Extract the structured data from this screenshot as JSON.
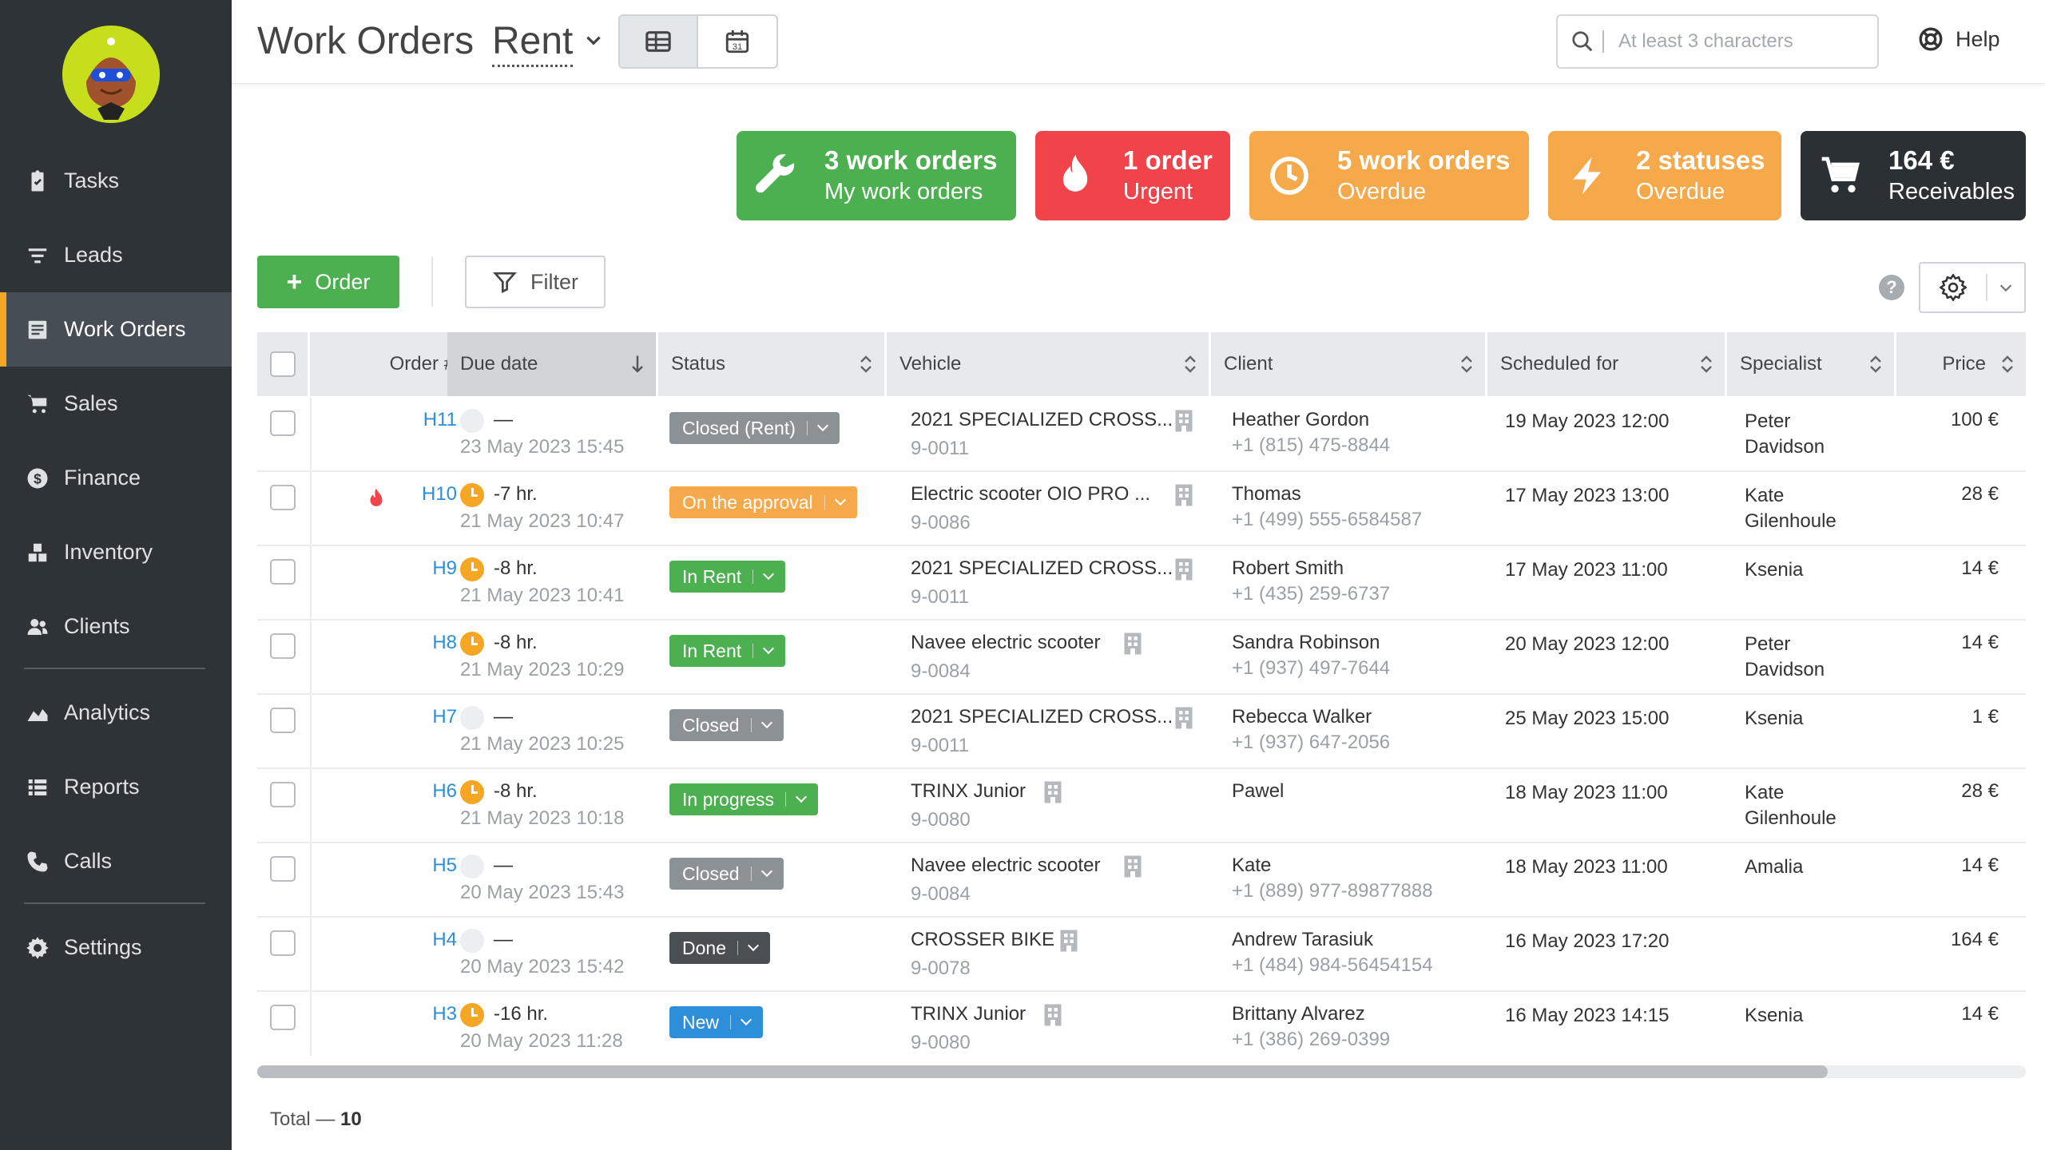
{
  "nav": {
    "tasks": "Tasks",
    "leads": "Leads",
    "work_orders": "Work Orders",
    "sales": "Sales",
    "finance": "Finance",
    "inventory": "Inventory",
    "clients": "Clients",
    "analytics": "Analytics",
    "reports": "Reports",
    "calls": "Calls",
    "settings": "Settings"
  },
  "header": {
    "title": "Work Orders",
    "subtitle": "Rent",
    "search_placeholder": "At least 3 characters",
    "help": "Help"
  },
  "cards": [
    {
      "line1": "3 work orders",
      "line2": "My work orders",
      "color": "#4caf50",
      "icon": "wrench-icon"
    },
    {
      "line1": "1 order",
      "line2": "Urgent",
      "color": "#f0434a",
      "icon": "flame-icon"
    },
    {
      "line1": "5 work orders",
      "line2": "Overdue",
      "color": "#f5a94a",
      "icon": "clock-icon"
    },
    {
      "line1": "2 statuses",
      "line2": "Overdue",
      "color": "#f5a94a",
      "icon": "lightning-icon"
    },
    {
      "line1": "164 €",
      "line2": "Receivables",
      "color": "#2b3035",
      "icon": "cart-icon"
    }
  ],
  "actions": {
    "order": "Order",
    "filter": "Filter",
    "help_mark": "?"
  },
  "columns": {
    "order": "Order #",
    "due": "Due date",
    "status": "Status",
    "vehicle": "Vehicle",
    "client": "Client",
    "scheduled": "Scheduled for",
    "specialist": "Specialist",
    "price": "Price"
  },
  "rows": [
    {
      "order": "H11",
      "urgent": false,
      "due_icon": "gray",
      "due_top": "—",
      "due_bottom": "23 May 2023 15:45",
      "status": "Closed (Rent)",
      "status_color": "#8c9196",
      "vehicle": "2021 SPECIALIZED CROSS...",
      "vehicle_id": "9-0011",
      "client": "Heather Gordon",
      "phone": "+1 (815) 475-8844",
      "scheduled": "19 May 2023 12:00",
      "specialist_1": "Peter",
      "specialist_2": "Davidson",
      "price": "100 €"
    },
    {
      "order": "H10",
      "urgent": true,
      "due_icon": "orange",
      "due_top": "-7 hr.",
      "due_bottom": "21 May 2023 10:47",
      "status": "On the approval",
      "status_color": "#f5a94a",
      "vehicle": "Electric scooter OIO PRO ...",
      "vehicle_id": "9-0086",
      "client": "Thomas",
      "phone": "+1 (499) 555-6584587",
      "scheduled": "17 May 2023 13:00",
      "specialist_1": "Kate",
      "specialist_2": "Gilenhoule",
      "price": "28 €"
    },
    {
      "order": "H9",
      "urgent": false,
      "due_icon": "orange",
      "due_top": "-8 hr.",
      "due_bottom": "21 May 2023 10:41",
      "status": "In Rent",
      "status_color": "#4caf50",
      "vehicle": "2021 SPECIALIZED CROSS...",
      "vehicle_id": "9-0011",
      "client": "Robert Smith",
      "phone": "+1 (435) 259-6737",
      "scheduled": "17 May 2023 11:00",
      "specialist_1": "Ksenia",
      "specialist_2": "",
      "price": "14 €"
    },
    {
      "order": "H8",
      "urgent": false,
      "due_icon": "orange",
      "due_top": "-8 hr.",
      "due_bottom": "21 May 2023 10:29",
      "status": "In Rent",
      "status_color": "#4caf50",
      "vehicle": "Navee electric scooter",
      "vehicle_id": "9-0084",
      "client": "Sandra Robinson",
      "phone": "+1 (937) 497-7644",
      "scheduled": "20 May 2023 12:00",
      "specialist_1": "Peter",
      "specialist_2": "Davidson",
      "price": "14 €"
    },
    {
      "order": "H7",
      "urgent": false,
      "due_icon": "gray",
      "due_top": "—",
      "due_bottom": "21 May 2023 10:25",
      "status": "Closed",
      "status_color": "#8c9196",
      "vehicle": "2021 SPECIALIZED CROSS...",
      "vehicle_id": "9-0011",
      "client": "Rebecca Walker",
      "phone": "+1 (937) 647-2056",
      "scheduled": "25 May 2023 15:00",
      "specialist_1": "Ksenia",
      "specialist_2": "",
      "price": "1 €"
    },
    {
      "order": "H6",
      "urgent": false,
      "due_icon": "orange",
      "due_top": "-8 hr.",
      "due_bottom": "21 May 2023 10:18",
      "status": "In progress",
      "status_color": "#4caf50",
      "vehicle": "TRINX Junior",
      "vehicle_id": "9-0080",
      "client": "Pawel",
      "phone": "",
      "scheduled": "18 May 2023 11:00",
      "specialist_1": "Kate",
      "specialist_2": "Gilenhoule",
      "price": "28 €"
    },
    {
      "order": "H5",
      "urgent": false,
      "due_icon": "gray",
      "due_top": "—",
      "due_bottom": "20 May 2023 15:43",
      "status": "Closed",
      "status_color": "#8c9196",
      "vehicle": "Navee electric scooter",
      "vehicle_id": "9-0084",
      "client": "Kate",
      "phone": "+1 (889) 977-89877888",
      "scheduled": "18 May 2023 11:00",
      "specialist_1": "Amalia",
      "specialist_2": "",
      "price": "14 €"
    },
    {
      "order": "H4",
      "urgent": false,
      "due_icon": "gray",
      "due_top": "—",
      "due_bottom": "20 May 2023 15:42",
      "status": "Done",
      "status_color": "#4a4f54",
      "vehicle": "CROSSER BIKE",
      "vehicle_id": "9-0078",
      "client": "Andrew Tarasiuk",
      "phone": "+1 (484) 984-56454154",
      "scheduled": "16 May 2023 17:20",
      "specialist_1": "",
      "specialist_2": "",
      "price": "164 €"
    },
    {
      "order": "H3",
      "urgent": false,
      "due_icon": "orange",
      "due_top": "-16 hr.",
      "due_bottom": "20 May 2023 11:28",
      "status": "New",
      "status_color": "#2d8ed9",
      "vehicle": "TRINX Junior",
      "vehicle_id": "9-0080",
      "client": "Brittany Alvarez",
      "phone": "+1 (386) 269-0399",
      "scheduled": "16 May 2023 14:15",
      "specialist_1": "Ksenia",
      "specialist_2": "",
      "price": "14 €"
    }
  ],
  "footer": {
    "total_label": "Total —",
    "total_value": "10"
  }
}
